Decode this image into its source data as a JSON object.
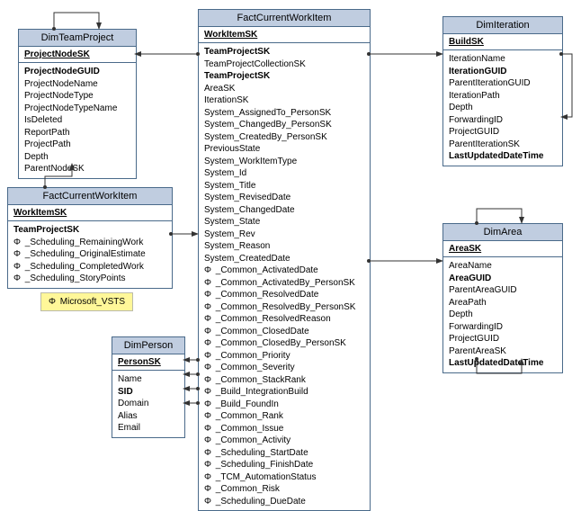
{
  "phi": "Φ",
  "legend": "Microsoft_VSTS",
  "tables": {
    "dimTeamProject": {
      "title": "DimTeamProject",
      "key": "ProjectNodeSK",
      "rows": [
        "ProjectNodeGUID",
        "ProjectNodeName",
        "ProjectNodeType",
        "ProjectNodeTypeName",
        "IsDeleted",
        "ReportPath",
        "ProjectPath",
        "Depth",
        "ParentNodeSK"
      ],
      "bold": [
        "ProjectNodeGUID"
      ]
    },
    "factCWILeft": {
      "title": "FactCurrentWorkItem",
      "key": "WorkItemSK",
      "rows": [
        "TeamProjectSK",
        "_Scheduling_RemainingWork",
        "_Scheduling_OriginalEstimate",
        "_Scheduling_CompletedWork",
        "_Scheduling_StoryPoints"
      ],
      "bold": [
        "TeamProjectSK"
      ],
      "phiRows": [
        "_Scheduling_RemainingWork",
        "_Scheduling_OriginalEstimate",
        "_Scheduling_CompletedWork",
        "_Scheduling_StoryPoints"
      ]
    },
    "factCWIMain": {
      "title": "FactCurrentWorkItem",
      "key": "WorkItemSK",
      "rows": [
        "TeamProjectSK",
        "TeamProjectCollectionSK",
        "TeamProjectSK",
        "AreaSK",
        "IterationSK",
        "System_AssignedTo_PersonSK",
        "System_ChangedBy_PersonSK",
        "System_CreatedBy_PersonSK",
        "PreviousState",
        "System_WorkItemType",
        "System_Id",
        "System_Title",
        "System_RevisedDate",
        "System_ChangedDate",
        "System_State",
        "System_Rev",
        "System_Reason",
        "System_CreatedDate",
        "_Common_ActivatedDate",
        "_Common_ActivatedBy_PersonSK",
        "_Common_ResolvedDate",
        "_Common_ResolvedBy_PersonSK",
        "_Common_ResolvedReason",
        "_Common_ClosedDate",
        "_Common_ClosedBy_PersonSK",
        "_Common_Priority",
        "_Common_Severity",
        "_Common_StackRank",
        "_Build_IntegrationBuild",
        "_Build_FoundIn",
        "_Common_Rank",
        "_Common_Issue",
        "_Common_Activity",
        "_Scheduling_StartDate",
        "_Scheduling_FinishDate",
        "_TCM_AutomationStatus",
        "_Common_Risk",
        "_Scheduling_DueDate"
      ],
      "bold": [
        "TeamProjectSK"
      ],
      "phiRows": [
        "_Common_ActivatedDate",
        "_Common_ActivatedBy_PersonSK",
        "_Common_ResolvedDate",
        "_Common_ResolvedBy_PersonSK",
        "_Common_ResolvedReason",
        "_Common_ClosedDate",
        "_Common_ClosedBy_PersonSK",
        "_Common_Priority",
        "_Common_Severity",
        "_Common_StackRank",
        "_Build_IntegrationBuild",
        "_Build_FoundIn",
        "_Common_Rank",
        "_Common_Issue",
        "_Common_Activity",
        "_Scheduling_StartDate",
        "_Scheduling_FinishDate",
        "_TCM_AutomationStatus",
        "_Common_Risk",
        "_Scheduling_DueDate"
      ]
    },
    "dimIteration": {
      "title": "DimIteration",
      "key": "BuildSK",
      "rows": [
        "IterationName",
        "IterationGUID",
        "ParentIterationGUID",
        "IterationPath",
        "Depth",
        "ForwardingID",
        "ProjectGUID",
        "ParentIterationSK",
        "LastUpdatedDateTime"
      ],
      "bold": [
        "IterationGUID",
        "LastUpdatedDateTime"
      ]
    },
    "dimArea": {
      "title": "DimArea",
      "key": "AreaSK",
      "rows": [
        "AreaName",
        "AreaGUID",
        "ParentAreaGUID",
        "AreaPath",
        "Depth",
        "ForwardingID",
        "ProjectGUID",
        "ParentAreaSK",
        "LastUpdatedDateTime"
      ],
      "bold": [
        "AreaGUID",
        "LastUpdatedDateTime"
      ]
    },
    "dimPerson": {
      "title": "DimPerson",
      "key": "PersonSK",
      "rows": [
        "Name",
        "SID",
        "Domain",
        "Alias",
        "Email"
      ],
      "bold": [
        "SID"
      ]
    }
  }
}
